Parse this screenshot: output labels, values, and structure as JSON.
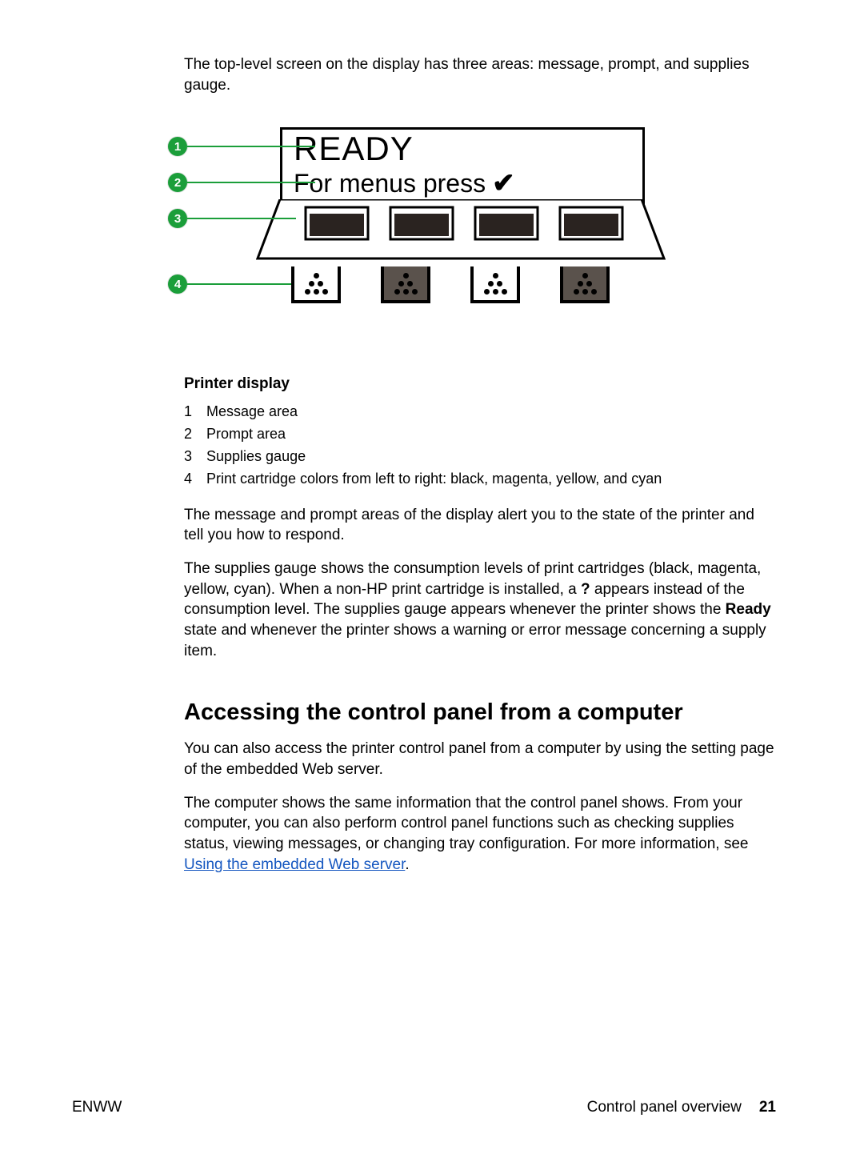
{
  "intro": "The top-level screen on the display has three areas: message, prompt, and supplies gauge.",
  "diagram": {
    "callouts": [
      "1",
      "2",
      "3",
      "4"
    ],
    "lcd_line1": "READY",
    "lcd_line2": "For menus press",
    "tick_glyph": "✔"
  },
  "caption_title": "Printer display",
  "captions": {
    "1": "Message area",
    "2": "Prompt area",
    "3": "Supplies gauge",
    "4": "Print cartridge colors from left to right: black, magenta, yellow, and cyan"
  },
  "para_after_1": "The message and prompt areas of the display alert you to the state of the printer and tell you how to respond.",
  "para_after_2_a": "The supplies gauge shows the consumption levels of print cartridges (black, magenta, yellow, cyan). When a non-HP print cartridge is installed, a ",
  "para_after_2_q": "?",
  "para_after_2_b": " appears instead of the consumption level. The supplies gauge appears whenever the printer shows the ",
  "para_after_2_ready": "Ready",
  "para_after_2_c": " state and whenever the printer shows a warning or error message concerning a supply item.",
  "heading": "Accessing the control panel from a computer",
  "para_h1": "You can also access the printer control panel from a computer by using the setting page of the embedded Web server.",
  "para_h2_a": "The computer shows the same information that the control panel shows. From your computer, you can also perform control panel functions such as checking supplies status, viewing messages, or changing tray configuration. For more information, see ",
  "para_h2_link": "Using the embedded Web server",
  "para_h2_b": ".",
  "footer": {
    "left": "ENWW",
    "right_text": "Control panel overview",
    "page": "21"
  }
}
